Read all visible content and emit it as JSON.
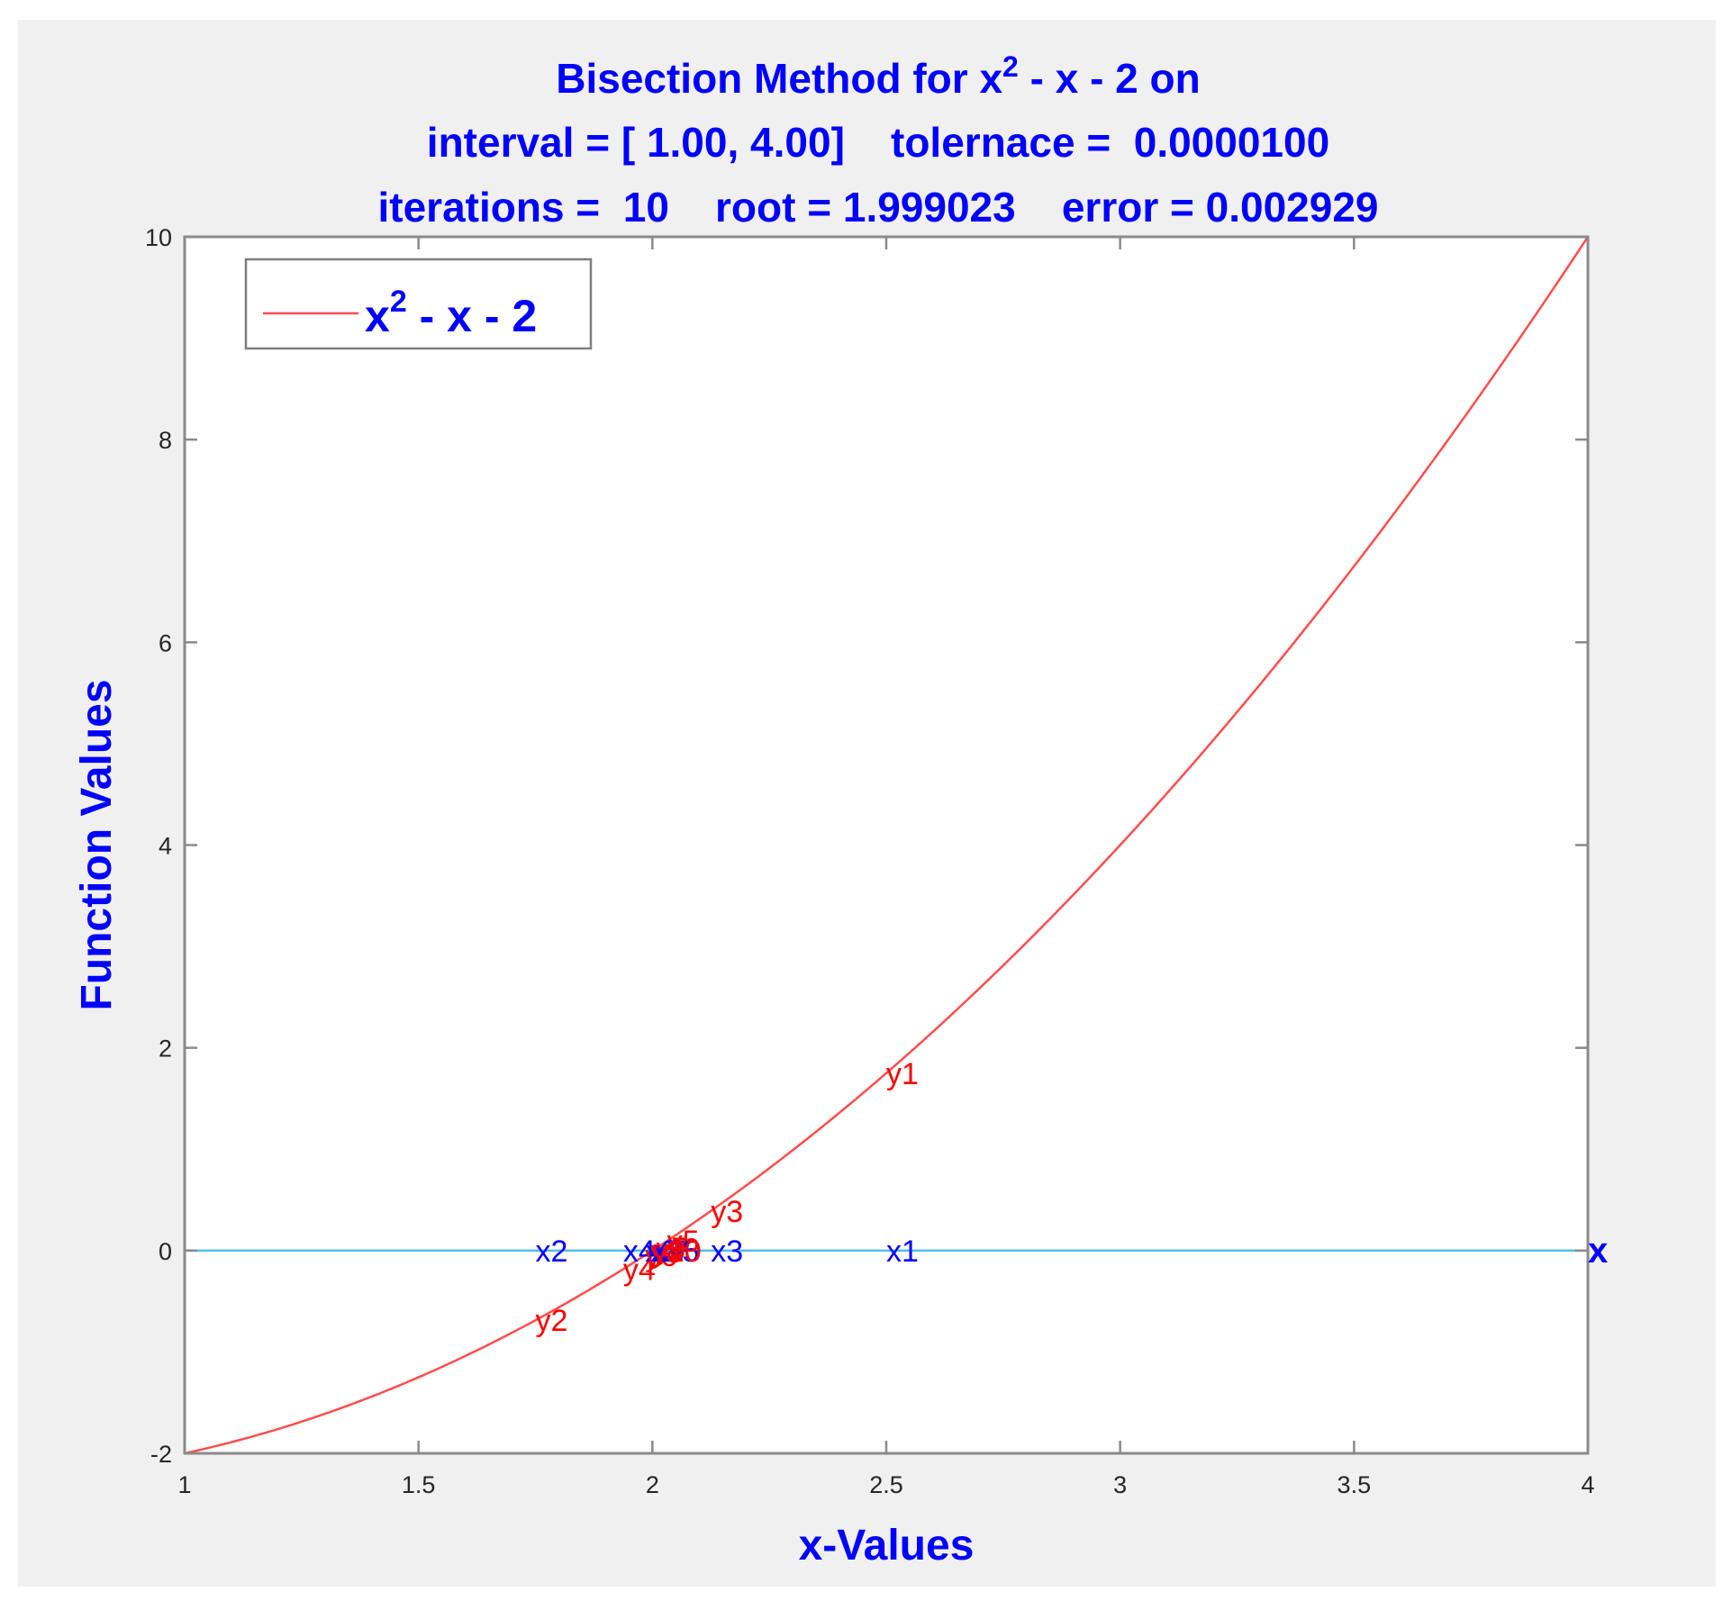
{
  "chart_data": {
    "type": "line",
    "title": [
      "Bisection Method for x^2 - x - 2 on",
      "interval = [ 1.00, 4.00]    tolernace =  0.0000100",
      "iterations =  10    root = 1.999023    error = 0.002929"
    ],
    "title_parts": {
      "line1_pre": "Bisection Method for x",
      "line1_sup": "2",
      "line1_post": " - x - 2 on",
      "line2": "interval = [ 1.00, 4.00]    tolernace =  0.0000100",
      "line3": "iterations =  10    root = 1.999023    error = 0.002929"
    },
    "xlabel": "x-Values",
    "ylabel": "Function Values",
    "xlim": [
      1,
      4
    ],
    "ylim": [
      -2,
      10
    ],
    "xticks": [
      1,
      1.5,
      2,
      2.5,
      3,
      3.5,
      4
    ],
    "xtick_labels": [
      "1",
      "1.5",
      "2",
      "2.5",
      "3",
      "3.5",
      "4"
    ],
    "yticks": [
      -2,
      0,
      2,
      4,
      6,
      8,
      10
    ],
    "ytick_labels": [
      "-2",
      "0",
      "2",
      "4",
      "6",
      "8",
      "10"
    ],
    "grid": false,
    "legend": {
      "placement": "top-left",
      "entries": [
        {
          "label_base": "x",
          "label_sup": "2",
          "label_rest": " - x - 2",
          "color": "#ff4d4d"
        }
      ]
    },
    "series": [
      {
        "name": "x^2 - x - 2",
        "function": "x^2 - x - 2",
        "x_range": [
          1,
          4
        ],
        "color": "#ff4d4d"
      },
      {
        "name": "zero line",
        "x": [
          1,
          4
        ],
        "y": [
          0,
          0
        ],
        "color": "#4dbeee"
      }
    ],
    "iterations": [
      {
        "k": 1,
        "x": 2.5,
        "fx": 1.75
      },
      {
        "k": 2,
        "x": 1.75,
        "fx": -0.6875
      },
      {
        "k": 3,
        "x": 2.125,
        "fx": 0.390625
      },
      {
        "k": 4,
        "x": 1.9375,
        "fx": -0.18359375
      },
      {
        "k": 5,
        "x": 2.03125,
        "fx": 0.0947265625
      },
      {
        "k": 6,
        "x": 1.984375,
        "fx": -0.046630859375
      },
      {
        "k": 7,
        "x": 2.0078125,
        "fx": 0.02349853515625
      },
      {
        "k": 8,
        "x": 1.99609375,
        "fx": -0.0116996765
      },
      {
        "k": 9,
        "x": 2.001953125,
        "fx": 0.0058631897
      },
      {
        "k": 10,
        "x": 1.9990234375,
        "fx": -0.0029287338
      }
    ],
    "annotations": {
      "x_label_prefix": "x",
      "y_label_prefix": "y",
      "x_label_color": "#0000ff",
      "y_label_color": "#ff0000",
      "endpoint_marker": {
        "text": "x",
        "x": 4,
        "y": 0,
        "color": "#0000ff"
      }
    },
    "root": 1.999023,
    "error": 0.002929,
    "tolerance": 1e-05,
    "iteration_count": 10,
    "interval": [
      1.0,
      4.0
    ]
  },
  "colors": {
    "figure_bg": "#f0f0f0",
    "axes_bg": "#ffffff",
    "axis_color": "#808080",
    "text_blue": "#0000ff",
    "text_red": "#ff0000"
  }
}
